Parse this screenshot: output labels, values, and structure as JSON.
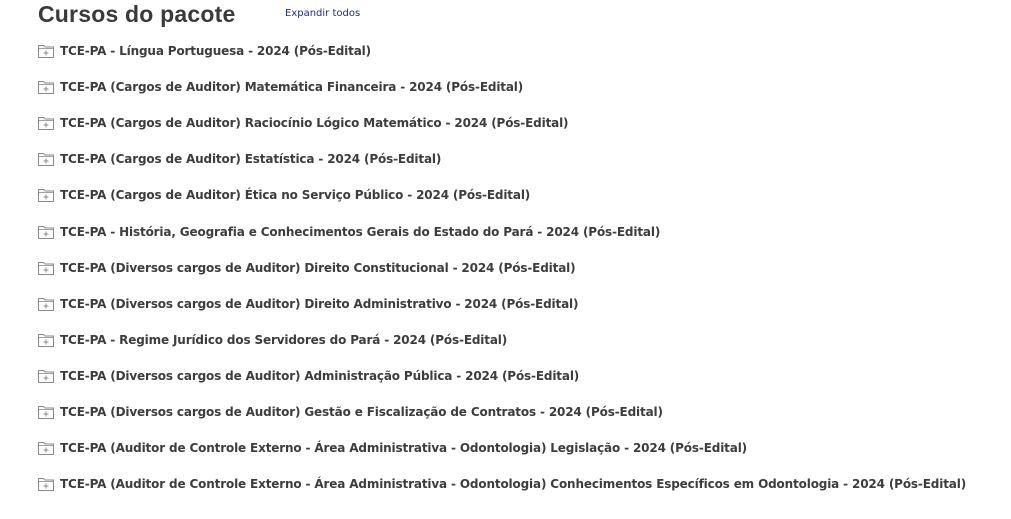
{
  "header": {
    "title": "Cursos do pacote",
    "expand_all_label": "Expandir todos"
  },
  "colors": {
    "link": "#1f2a9b",
    "text": "#3d3d3d",
    "icon": "#8a8a8a"
  },
  "icons": {
    "course_item": "folder-plus-icon"
  },
  "courses": [
    {
      "label": "TCE-PA - Língua Portuguesa - 2024 (Pós-Edital)"
    },
    {
      "label": "TCE-PA (Cargos de Auditor) Matemática Financeira - 2024 (Pós-Edital)"
    },
    {
      "label": "TCE-PA (Cargos de Auditor) Raciocínio Lógico Matemático - 2024 (Pós-Edital)"
    },
    {
      "label": "TCE-PA (Cargos de Auditor) Estatística - 2024 (Pós-Edital)"
    },
    {
      "label": "TCE-PA (Cargos de Auditor) Ética no Serviço Público - 2024 (Pós-Edital)"
    },
    {
      "label": "TCE-PA - História, Geografia e Conhecimentos Gerais do Estado do Pará - 2024 (Pós-Edital)"
    },
    {
      "label": "TCE-PA (Diversos cargos de Auditor) Direito Constitucional - 2024 (Pós-Edital)"
    },
    {
      "label": "TCE-PA (Diversos cargos de Auditor) Direito Administrativo - 2024 (Pós-Edital)"
    },
    {
      "label": "TCE-PA - Regime Jurídico dos Servidores do Pará - 2024 (Pós-Edital)"
    },
    {
      "label": "TCE-PA (Diversos cargos de Auditor) Administração Pública - 2024 (Pós-Edital)"
    },
    {
      "label": "TCE-PA (Diversos cargos de Auditor) Gestão e Fiscalização de Contratos - 2024 (Pós-Edital)"
    },
    {
      "label": "TCE-PA (Auditor de Controle Externo - Área Administrativa - Odontologia) Legislação - 2024 (Pós-Edital)"
    },
    {
      "label": "TCE-PA (Auditor de Controle Externo - Área Administrativa - Odontologia) Conhecimentos Específicos em Odontologia - 2024 (Pós-Edital)"
    }
  ]
}
